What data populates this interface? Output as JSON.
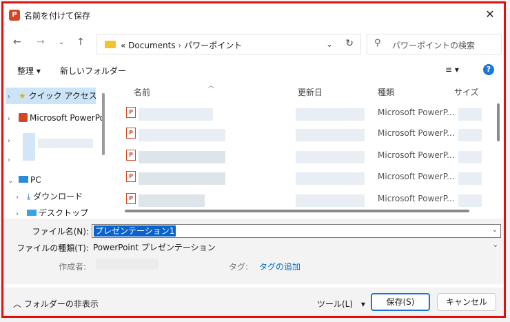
{
  "window": {
    "title": "名前を付けて保存",
    "app_icon_text": "P"
  },
  "address": {
    "prefix": "«",
    "path": [
      "Documents",
      "パワーポイント"
    ],
    "separator": "›"
  },
  "search": {
    "placeholder": "パワーポイントの検索"
  },
  "toolbar": {
    "organize_label": "整理 ▾",
    "new_folder_label": "新しいフォルダー",
    "view_label": "≡ ▾",
    "help_label": "?"
  },
  "nav": {
    "quick_access": "クイック アクセス",
    "ppt": "Microsoft PowerPoint",
    "pc": "PC",
    "downloads": "ダウンロード",
    "desktop": "デスクトップ"
  },
  "file_list": {
    "columns": [
      "名前",
      "更新日",
      "種類",
      "サイズ"
    ],
    "rows": [
      {
        "type": "Microsoft PowerP..."
      },
      {
        "type": "Microsoft PowerP..."
      },
      {
        "type": "Microsoft PowerP..."
      },
      {
        "type": "Microsoft PowerP..."
      },
      {
        "type": "Microsoft PowerP..."
      }
    ]
  },
  "form": {
    "filename_label": "ファイル名(N):",
    "filename_value": "プレゼンテーション1",
    "filetype_label": "ファイルの種類(T):",
    "filetype_value": "PowerPoint プレゼンテーション",
    "author_label": "作成者:",
    "tag_label": "タグ:",
    "tag_add": "タグの追加"
  },
  "bottom": {
    "hide_folders": "フォルダーの非表示",
    "tools_label": "ツール(L)",
    "save_label": "保存(S)",
    "cancel_label": "キャンセル"
  }
}
